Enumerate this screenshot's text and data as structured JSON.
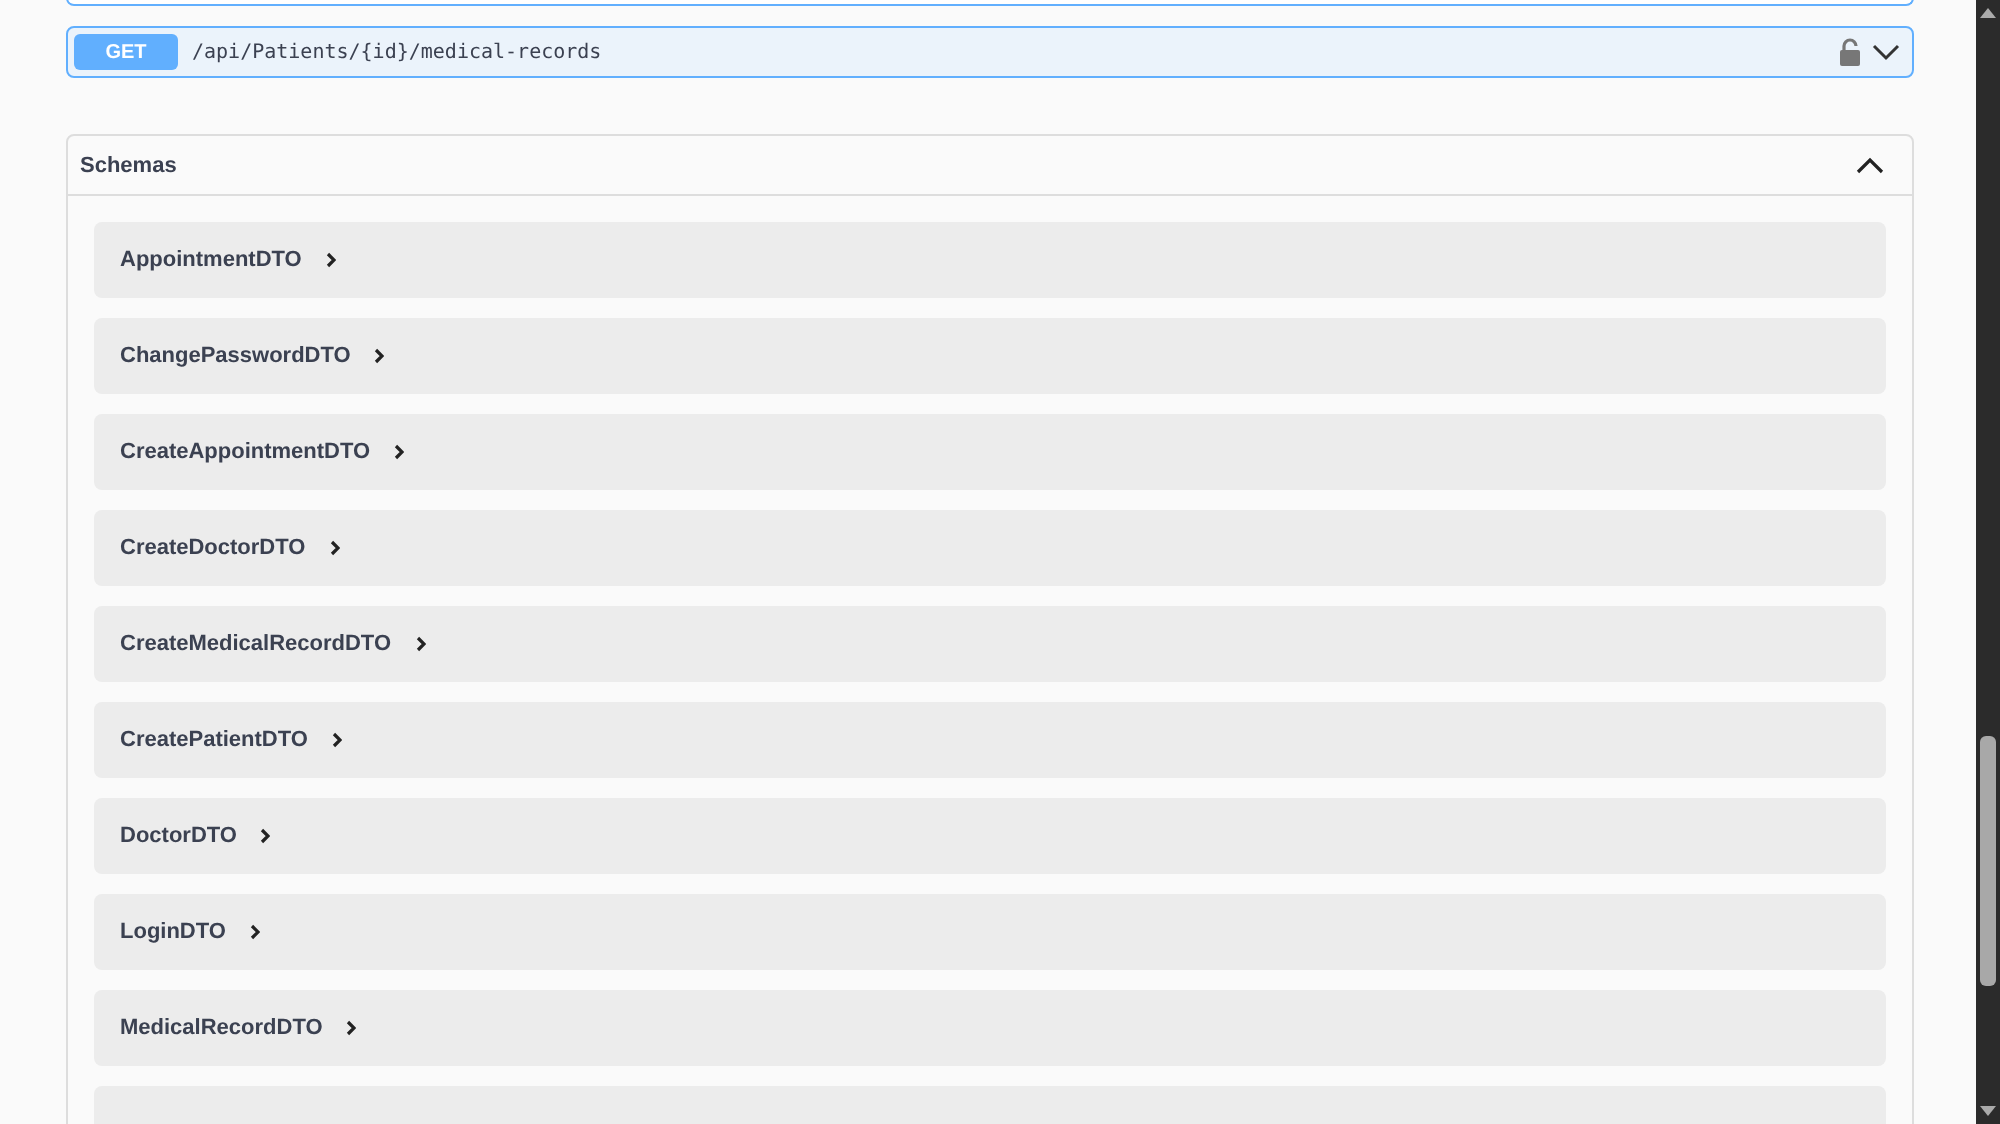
{
  "operation": {
    "method": "GET",
    "path": "/api/Patients/{id}/medical-records",
    "locked": false,
    "expanded": false
  },
  "schemas": {
    "title": "Schemas",
    "expanded": true,
    "items": [
      {
        "name": "AppointmentDTO"
      },
      {
        "name": "ChangePasswordDTO"
      },
      {
        "name": "CreateAppointmentDTO"
      },
      {
        "name": "CreateDoctorDTO"
      },
      {
        "name": "CreateMedicalRecordDTO"
      },
      {
        "name": "CreatePatientDTO"
      },
      {
        "name": "DoctorDTO"
      },
      {
        "name": "LoginDTO"
      },
      {
        "name": "MedicalRecordDTO"
      }
    ],
    "more_rows_below": true
  }
}
